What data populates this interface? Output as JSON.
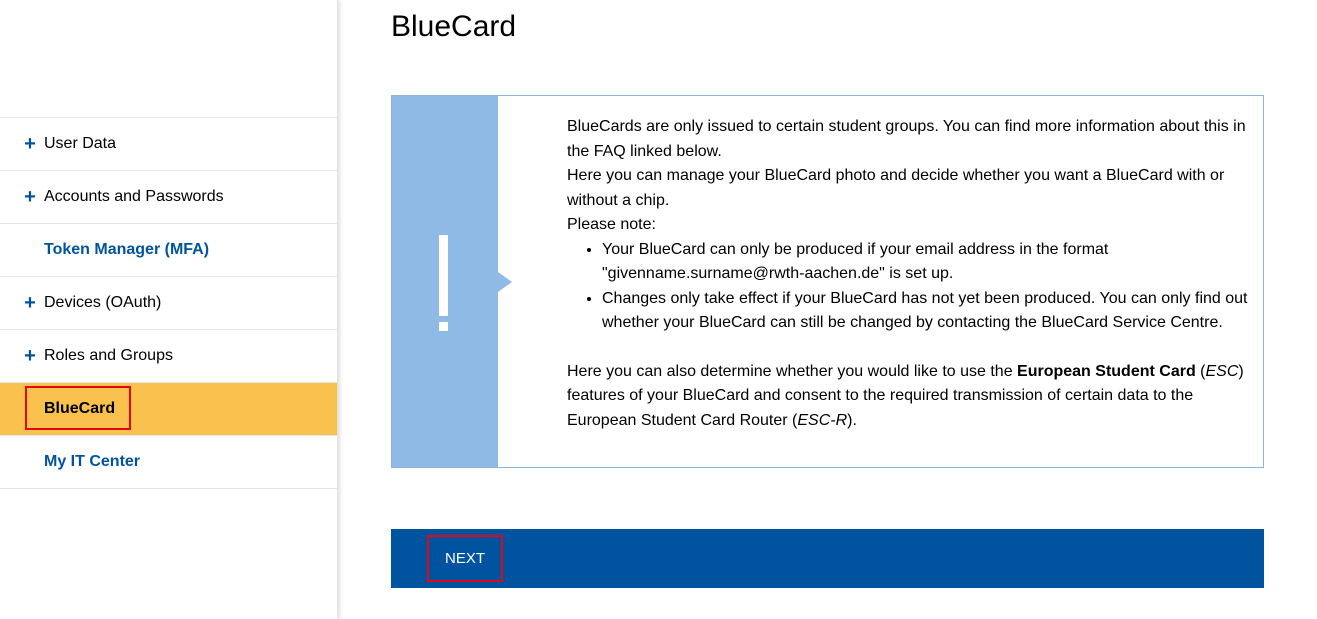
{
  "sidebar": {
    "items": [
      {
        "label": "User Data"
      },
      {
        "label": "Accounts and Passwords"
      },
      {
        "label": "Token Manager (MFA)"
      },
      {
        "label": "Devices (OAuth)"
      },
      {
        "label": "Roles and Groups"
      },
      {
        "label": "BlueCard"
      },
      {
        "label": "My IT Center"
      }
    ]
  },
  "main": {
    "title": "BlueCard",
    "notice": {
      "p1": "BlueCards are only issued to certain student groups. You can find more information about this in the FAQ linked below.",
      "p2": "Here you can manage your BlueCard photo and decide whether you want a BlueCard with or without a chip.",
      "p3": "Please note:",
      "bullets": [
        "Your BlueCard can only be produced if your email address in the format \"givenname.surname@rwth-aachen.de\" is set up.",
        "Changes only take effect if your BlueCard has not yet been produced. You can only find out whether your BlueCard can still be changed by contacting the BlueCard Service Centre."
      ],
      "esc": {
        "t1": "Here you can also determine whether you would like to use the ",
        "bold": "European Student Card",
        "t2": " (",
        "abbr1": "ESC",
        "t3": ") features of your BlueCard and consent to the required transmission of certain data to the European Student Card Router (",
        "abbr2": "ESC-R",
        "t4": ")."
      }
    },
    "next_label": "NEXT"
  },
  "colors": {
    "brand_blue": "#00549f",
    "notice_blue": "#8ebae5",
    "active_yellow": "#f9c24f",
    "highlight_red": "#e30613"
  },
  "icons": {
    "expand": "plus-icon",
    "notice": "exclamation-icon"
  }
}
